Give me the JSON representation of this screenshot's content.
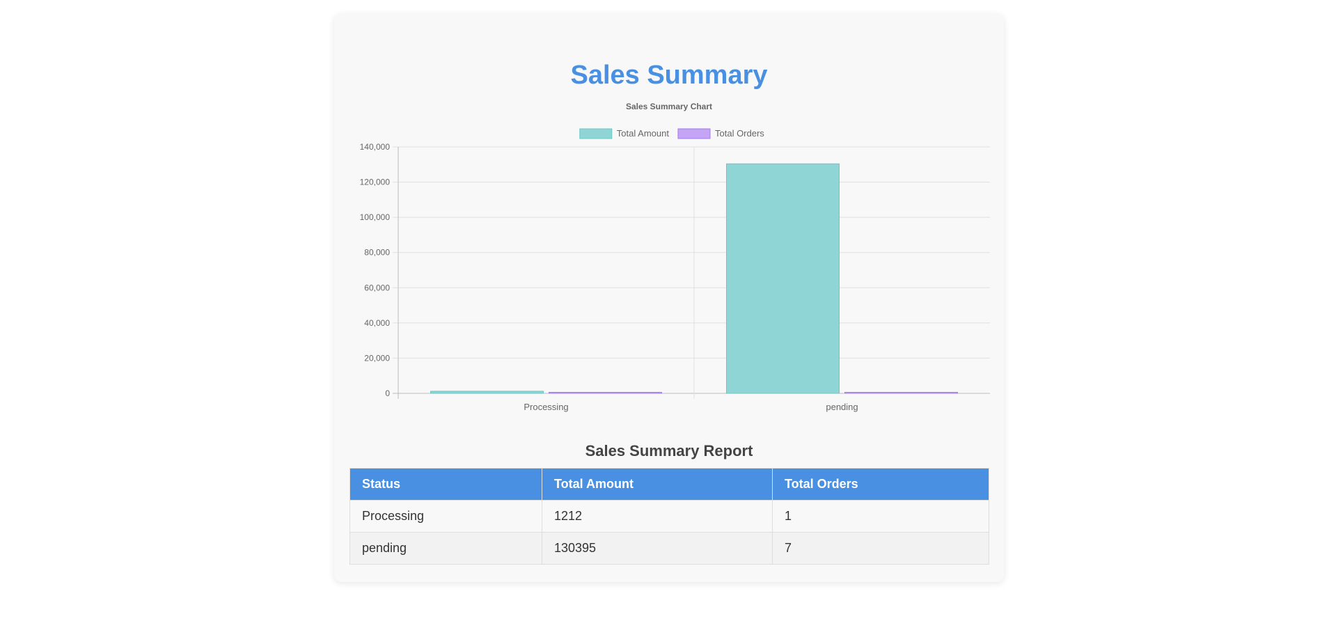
{
  "page": {
    "title": "Sales Summary",
    "report_title": "Sales Summary Report"
  },
  "chart_data": {
    "type": "bar",
    "title": "Sales Summary Chart",
    "categories": [
      "Processing",
      "pending"
    ],
    "series": [
      {
        "name": "Total Amount",
        "values": [
          1212,
          130395
        ],
        "color": "#8fd5d5",
        "border": "#6cc7c7"
      },
      {
        "name": "Total Orders",
        "values": [
          1,
          7
        ],
        "color": "#c3a4f5",
        "border": "#a57cf0"
      }
    ],
    "ylim": [
      0,
      140000
    ],
    "yticks": [
      0,
      20000,
      40000,
      60000,
      80000,
      100000,
      120000,
      140000
    ],
    "ytick_labels": [
      "0",
      "20,000",
      "40,000",
      "60,000",
      "80,000",
      "100,000",
      "120,000",
      "140,000"
    ],
    "grid": true,
    "legend_position": "top"
  },
  "table": {
    "headers": [
      "Status",
      "Total Amount",
      "Total Orders"
    ],
    "rows": [
      [
        "Processing",
        "1212",
        "1"
      ],
      [
        "pending",
        "130395",
        "7"
      ]
    ]
  }
}
